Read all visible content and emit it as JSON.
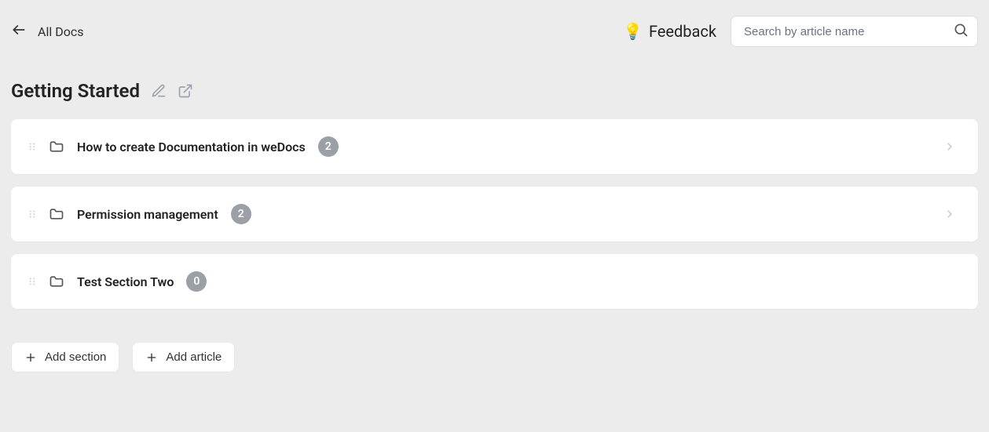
{
  "nav": {
    "back_label": "All Docs"
  },
  "feedback": {
    "label": "Feedback"
  },
  "search": {
    "placeholder": "Search by article name"
  },
  "page": {
    "title": "Getting Started"
  },
  "sections": [
    {
      "title": "How to create Documentation in weDocs",
      "count": "2",
      "has_chevron": true
    },
    {
      "title": "Permission management",
      "count": "2",
      "has_chevron": true
    },
    {
      "title": "Test Section Two",
      "count": "0",
      "has_chevron": false
    }
  ],
  "actions": {
    "add_section": "Add section",
    "add_article": "Add article"
  }
}
